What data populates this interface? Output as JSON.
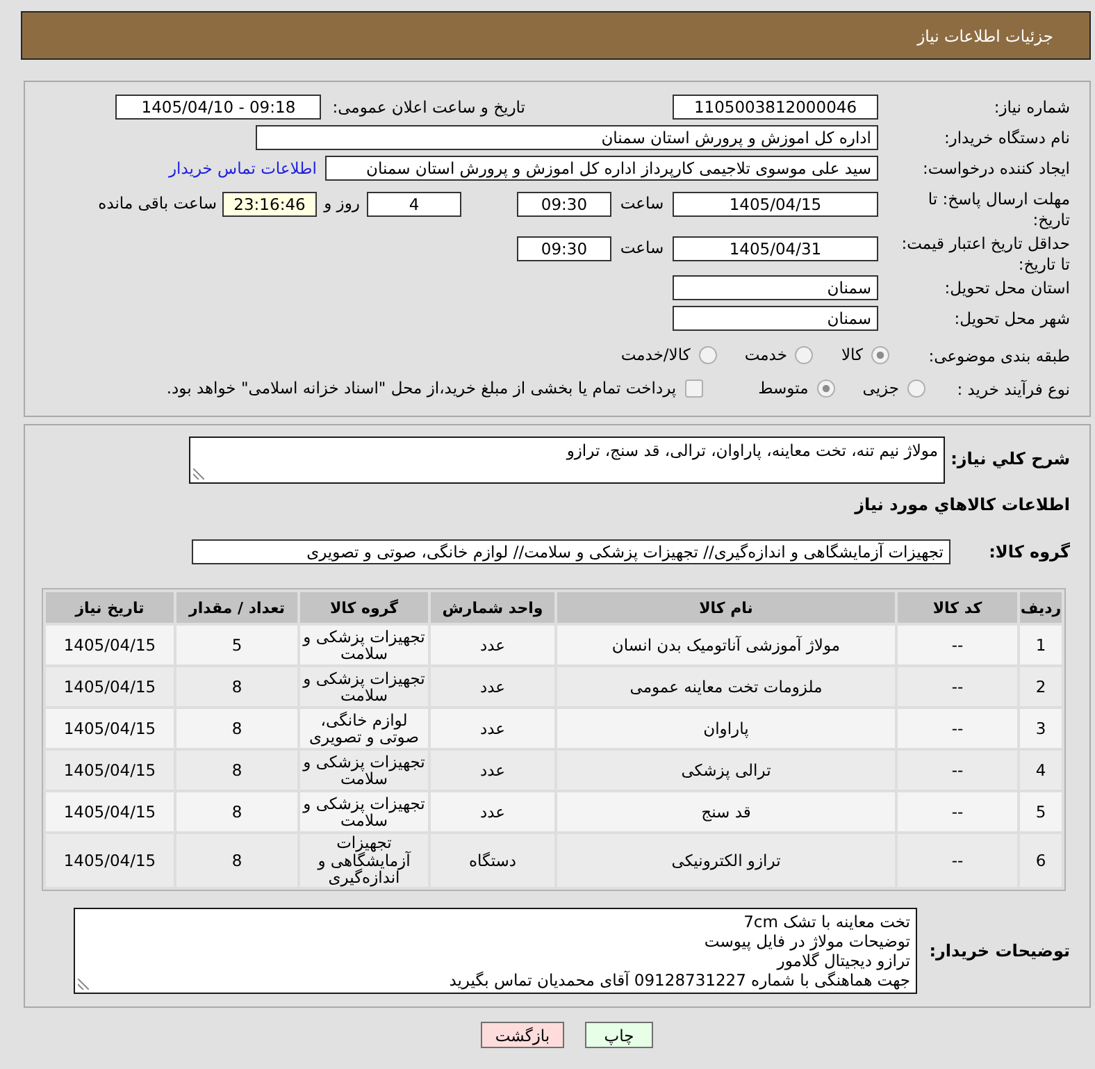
{
  "header": {
    "title": "جزئیات اطلاعات نیاز"
  },
  "details": {
    "need_number": {
      "label": "شماره نیاز:",
      "value": "1105003812000046"
    },
    "announce": {
      "label": "تاریخ و ساعت اعلان عمومی:",
      "value": "1405/04/10 - 09:18"
    },
    "buyer": {
      "label": "نام دستگاه خریدار:",
      "value": "اداره کل اموزش و پرورش استان سمنان"
    },
    "requester": {
      "label": "ایجاد کننده درخواست:",
      "value": "سید علی موسوی تلاجیمی کارپرداز اداره کل اموزش و پرورش استان سمنان",
      "link": "اطلاعات تماس خریدار"
    },
    "deadline": {
      "label": "مهلت ارسال پاسخ: تا تاریخ:",
      "date": "1405/04/15",
      "time_label": "ساعت",
      "time": "09:30",
      "days": "4",
      "days_label": "روز و",
      "remaining": "23:16:46",
      "remaining_label": "ساعت باقی مانده"
    },
    "validity": {
      "label": "حداقل تاریخ اعتبار قیمت: تا تاریخ:",
      "date": "1405/04/31",
      "time_label": "ساعت",
      "time": "09:30"
    },
    "province": {
      "label": "استان محل تحویل:",
      "value": "سمنان"
    },
    "city": {
      "label": "شهر محل تحویل:",
      "value": "سمنان"
    },
    "category": {
      "label": "طبقه بندی موضوعی:",
      "options": [
        {
          "label": "کالا",
          "selected": true
        },
        {
          "label": "خدمت",
          "selected": false
        },
        {
          "label": "کالا/خدمت",
          "selected": false
        }
      ]
    },
    "process": {
      "label": "نوع فرآیند خرید :",
      "options": [
        {
          "label": "جزیی",
          "selected": false
        },
        {
          "label": "متوسط",
          "selected": true
        }
      ],
      "treasury": {
        "label": "پرداخت تمام یا بخشی از مبلغ خرید،از محل \"اسناد خزانه اسلامی\" خواهد بود.",
        "checked": false
      }
    }
  },
  "summary": {
    "label": "شرح کلي نیاز:",
    "value": "مولاژ نیم تنه، تخت معاینه، پاراوان، ترالی، قد سنج، ترازو"
  },
  "goods": {
    "title": "اطلاعات کالاهاي مورد نیاز",
    "group_label": "گروه کالا:",
    "group": "تجهیزات آزمایشگاهی و اندازه‌گیری// تجهیزات پزشکی و سلامت// لوازم خانگی، صوتی و تصویری",
    "columns": [
      "ردیف",
      "کد کالا",
      "نام کالا",
      "واحد شمارش",
      "گروه کالا",
      "تعداد / مقدار",
      "تاریخ نیاز"
    ],
    "rows": [
      {
        "row": "1",
        "code": "--",
        "name": "مولاژ آموزشی آناتومیک بدن انسان",
        "unit": "عدد",
        "group": "تجهیزات پزشکی و سلامت",
        "quantity": "5",
        "date": "1405/04/15"
      },
      {
        "row": "2",
        "code": "--",
        "name": "ملزومات تخت معاینه عمومی",
        "unit": "عدد",
        "group": "تجهیزات پزشکی و سلامت",
        "quantity": "8",
        "date": "1405/04/15"
      },
      {
        "row": "3",
        "code": "--",
        "name": "پاراوان",
        "unit": "عدد",
        "group": "لوازم خانگی، صوتی و تصویری",
        "quantity": "8",
        "date": "1405/04/15"
      },
      {
        "row": "4",
        "code": "--",
        "name": "ترالی پزشکی",
        "unit": "عدد",
        "group": "تجهیزات پزشکی و سلامت",
        "quantity": "8",
        "date": "1405/04/15"
      },
      {
        "row": "5",
        "code": "--",
        "name": "قد سنج",
        "unit": "عدد",
        "group": "تجهیزات پزشکی و سلامت",
        "quantity": "8",
        "date": "1405/04/15"
      },
      {
        "row": "6",
        "code": "--",
        "name": "ترازو الکترونیکی",
        "unit": "دستگاه",
        "group": "تجهیزات آزمایشگاهی و اندازه‌گیری",
        "quantity": "8",
        "date": "1405/04/15"
      }
    ]
  },
  "buyer_notes": {
    "label": "توضیحات خریدار:",
    "lines": [
      "تخت معاینه با تشک 7cm",
      "توضیحات مولاژ در فایل پیوست",
      "ترازو دیجیتال گلامور",
      "جهت هماهنگی با شماره 09128731227 آقای محمدیان تماس بگیرید"
    ]
  },
  "buttons": [
    {
      "label": "چاپ",
      "kind": "print"
    },
    {
      "label": "بازگشت",
      "kind": "back"
    }
  ]
}
